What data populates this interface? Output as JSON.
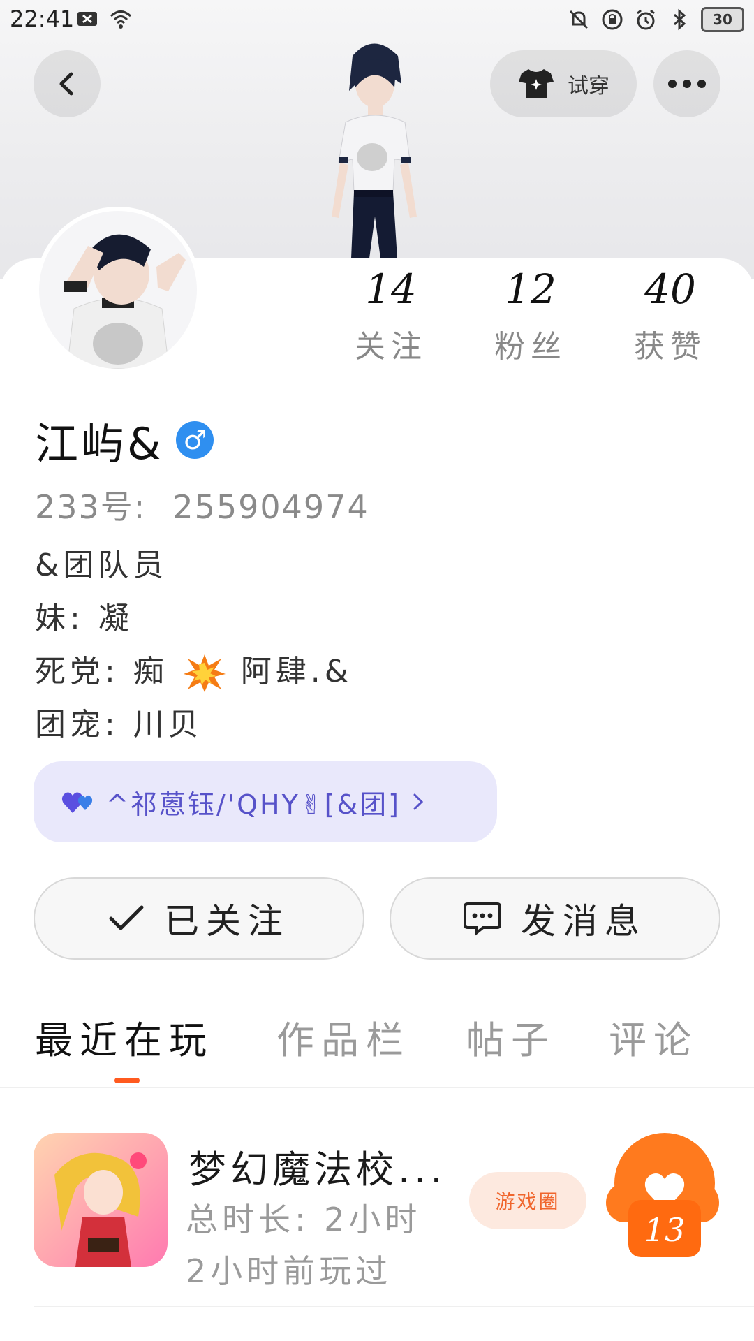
{
  "status": {
    "time": "22:41",
    "battery": "30"
  },
  "header": {
    "tryon_label": "试穿"
  },
  "profile": {
    "stats": [
      {
        "num": "14",
        "label": "关注"
      },
      {
        "num": "12",
        "label": "粉丝"
      },
      {
        "num": "40",
        "label": "获赞"
      }
    ],
    "name": "江屿&",
    "gender_symbol": "♂",
    "uid_label": "233号:",
    "uid_value": "255904974",
    "bio": {
      "line1": "&团队员",
      "line2": "妹:  凝",
      "line3_prefix": "死党:  痴",
      "line3_suffix": "阿肆.&",
      "line4": "团宠:  川贝"
    },
    "team_pill": "^祁蒽钰/'QHY✌[&团]"
  },
  "actions": {
    "follow_label": "已关注",
    "message_label": "发消息"
  },
  "tabs": [
    "最近在玩",
    "作品栏",
    "帖子",
    "评论"
  ],
  "recent_game": {
    "title": "梦幻魔法校...",
    "duration": "总时长:  2小时",
    "last_played": "2小时前玩过",
    "chip": "游戏圈",
    "likes": "13"
  },
  "colors": {
    "accent": "#ff5a1f",
    "gender": "#2f8ff0",
    "pill_bg": "#e9e8fb",
    "pill_text": "#5752c9"
  }
}
